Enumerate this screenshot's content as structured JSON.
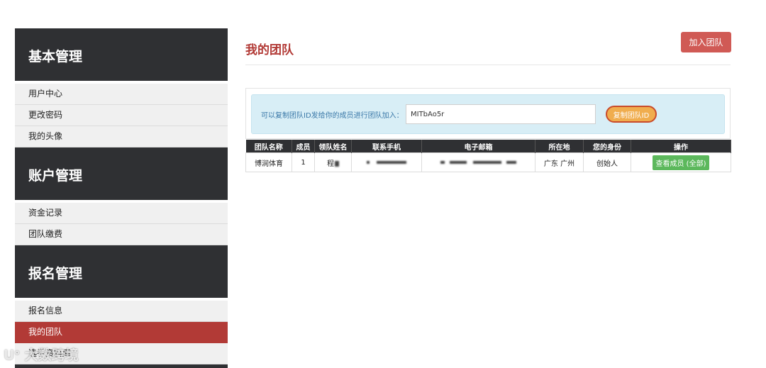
{
  "sidebar": {
    "sections": [
      {
        "title": "基本管理",
        "items": [
          "用户中心",
          "更改密码",
          "我的头像"
        ]
      },
      {
        "title": "账户管理",
        "items": [
          "资金记录",
          "团队缴费"
        ]
      },
      {
        "title": "报名管理",
        "items": [
          "报名信息",
          "我的团队",
          "选手资料库"
        ]
      }
    ],
    "active_item": "我的团队"
  },
  "page": {
    "title": "我的团队",
    "join_button": "加入团队"
  },
  "invite": {
    "label": "可以复制团队ID发给你的成员进行团队加入：",
    "team_id": "MITbAo5r",
    "copy_button": "复制团队ID"
  },
  "table": {
    "headers": [
      "团队名称",
      "成员",
      "领队姓名",
      "联系手机",
      "电子邮箱",
      "所在地",
      "您的身份",
      "操作"
    ],
    "rows": [
      {
        "team_name": "博润体育",
        "members": "1",
        "leader": "程",
        "location": "广东 广州",
        "role": "创始人",
        "action": "查看成员 (全部)"
      }
    ]
  },
  "watermark": "大数跨境",
  "colors": {
    "accent": "#b23a36",
    "dark": "#2f3033",
    "info_bg": "#d8eef6",
    "warn": "#f0ad4e",
    "success": "#5cb85c"
  }
}
